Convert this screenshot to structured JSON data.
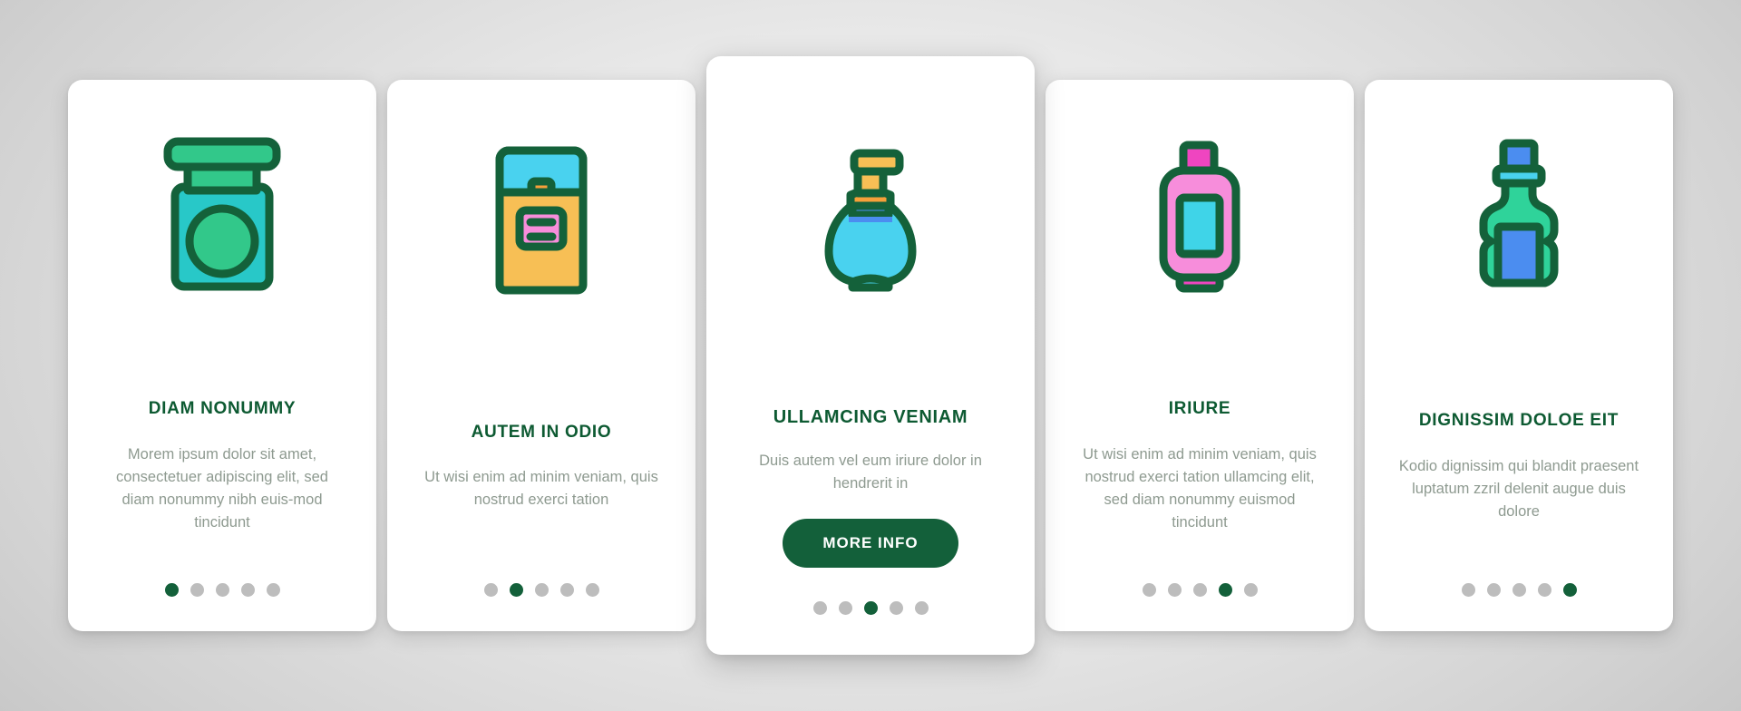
{
  "theme": {
    "accent_green": "#13603a",
    "title_green": "#0d5a32",
    "body_text_gray": "#8e9a90",
    "dot_inactive": "#bdbdbd",
    "card_background": "#ffffff",
    "page_background": "#d2d2d2"
  },
  "cards": [
    {
      "id": "card-1",
      "icon": "cosmetic-jar-icon",
      "title": "DIAM NONUMMY",
      "description": "Morem ipsum dolor sit amet, consectetuer adipiscing elit, sed diam nonummy nibh euis-mod tincidunt",
      "button": null,
      "dots": {
        "count": 5,
        "active_index": 0
      },
      "featured": false
    },
    {
      "id": "card-2",
      "icon": "shampoo-tube-icon",
      "title": "AUTEM IN ODIO",
      "description": "Ut wisi enim ad minim veniam, quis nostrud exerci tation",
      "button": null,
      "dots": {
        "count": 5,
        "active_index": 1
      },
      "featured": false
    },
    {
      "id": "card-3",
      "icon": "pump-dispenser-bottle-icon",
      "title": "ULLAMCING VENIAM",
      "description": "Duis autem vel eum iriure dolor in hendrerit in",
      "button": "MORE INFO",
      "dots": {
        "count": 5,
        "active_index": 2
      },
      "featured": true
    },
    {
      "id": "card-4",
      "icon": "lotion-bottle-icon",
      "title": "IRIURE",
      "description": "Ut wisi enim ad minim veniam, quis nostrud exerci tation ullamcing elit, sed diam nonummy euismod tincidunt",
      "button": null,
      "dots": {
        "count": 5,
        "active_index": 3
      },
      "featured": false
    },
    {
      "id": "card-5",
      "icon": "mouthwash-bottle-icon",
      "title": "DIGNISSIM DOLOE EIT",
      "description": "Kodio dignissim qui blandit praesent luptatum zzril delenit augue duis dolore",
      "button": null,
      "dots": {
        "count": 5,
        "active_index": 4
      },
      "featured": false
    }
  ]
}
